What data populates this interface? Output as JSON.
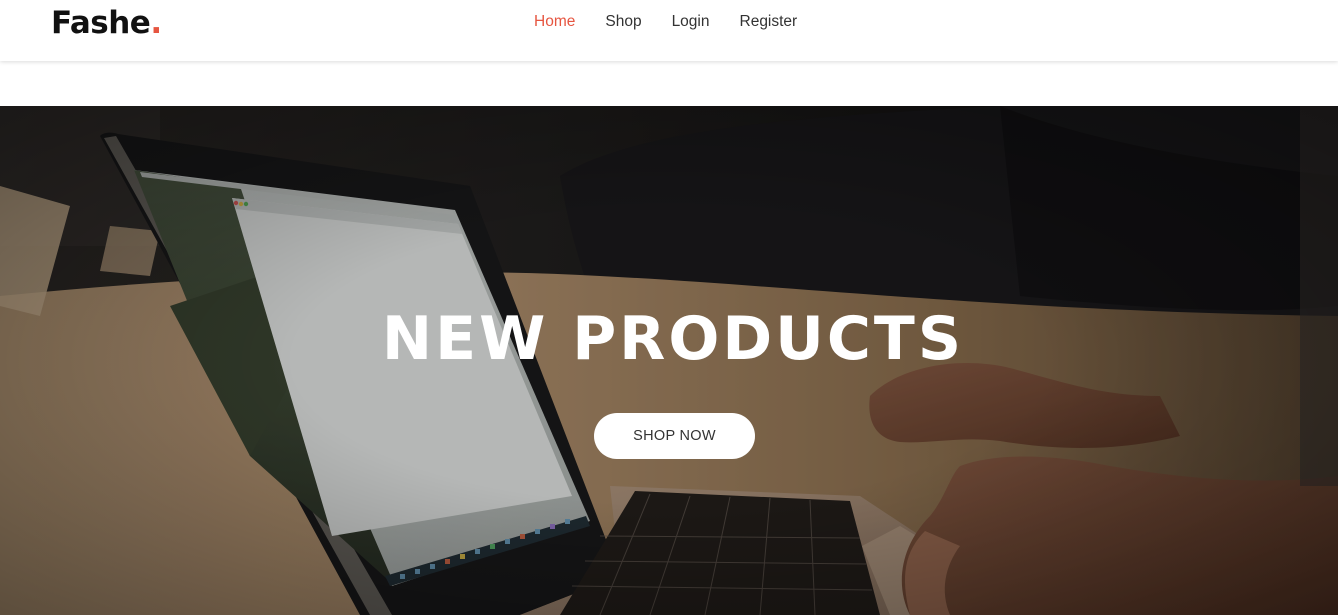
{
  "header": {
    "logo": {
      "text": "Fashe",
      "dot": "."
    },
    "nav": [
      {
        "label": "Home",
        "active": true
      },
      {
        "label": "Shop",
        "active": false
      },
      {
        "label": "Login",
        "active": false
      },
      {
        "label": "Register",
        "active": false
      }
    ]
  },
  "hero": {
    "title": "NEW PRODUCTS",
    "button_label": "SHOP NOW",
    "image": "laptop-on-wooden-desk-with-hands-photo"
  },
  "colors": {
    "accent": "#e65540",
    "nav_text": "#333333",
    "hero_text": "#ffffff",
    "button_bg": "#ffffff"
  }
}
